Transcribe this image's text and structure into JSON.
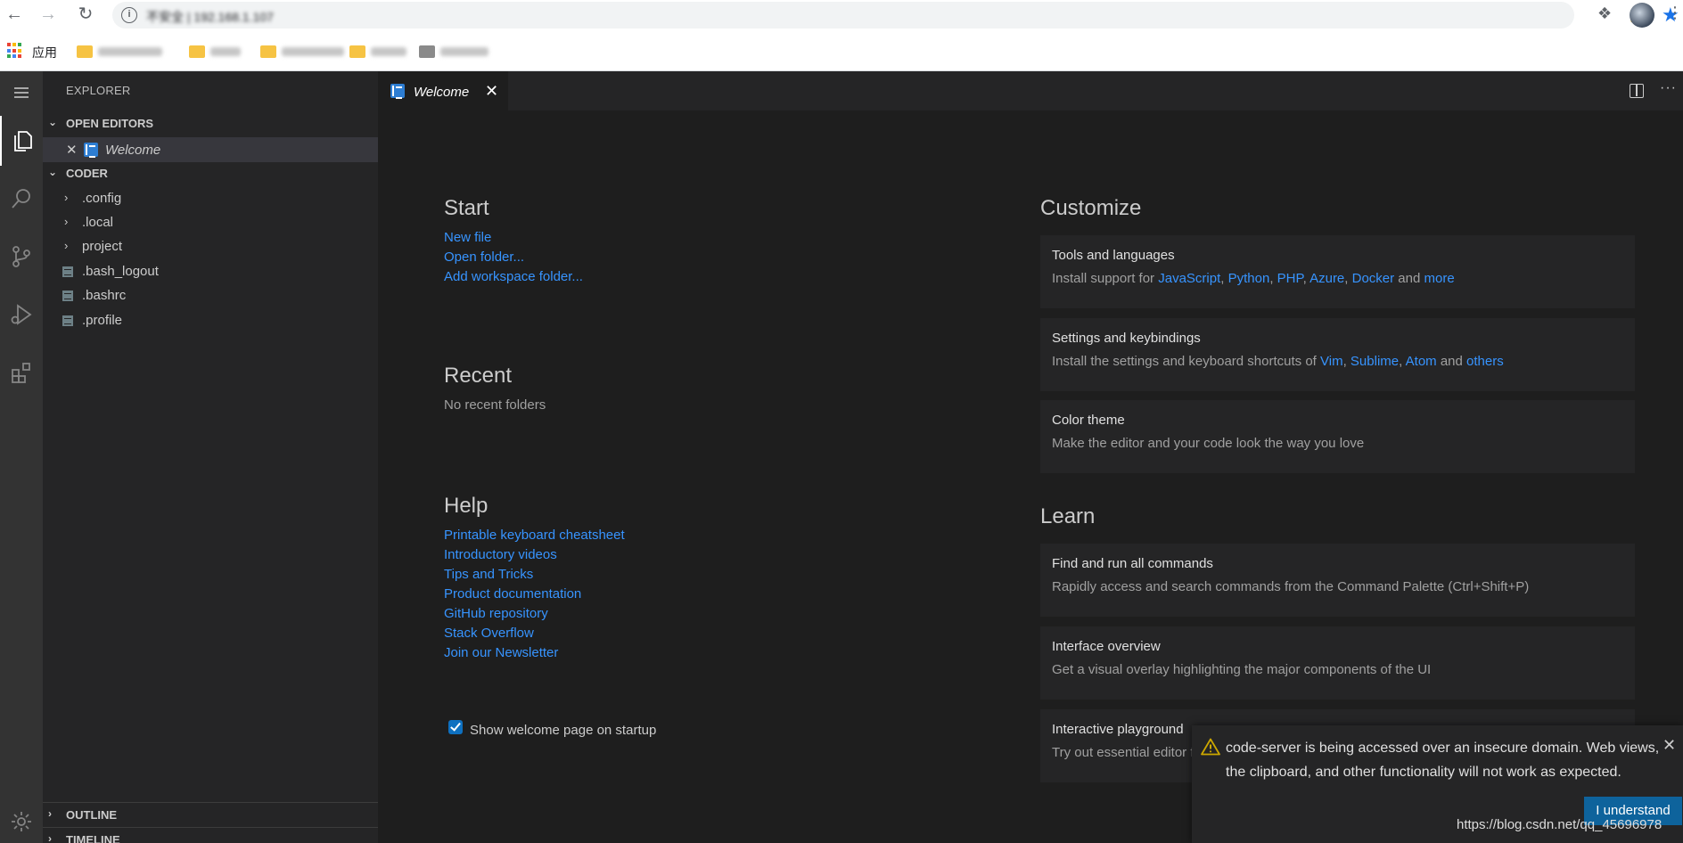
{
  "browser": {
    "url": "不安全 | 192.168.1.107",
    "apps_label": "应用"
  },
  "sidebar": {
    "title": "EXPLORER",
    "open_editors": "OPEN EDITORS",
    "open_editor_item": "Welcome",
    "folder": "CODER",
    "folders": [
      ".config",
      ".local",
      "project"
    ],
    "files": [
      ".bash_logout",
      ".bashrc",
      ".profile"
    ],
    "outline": "OUTLINE",
    "timeline": "TIMELINE"
  },
  "tab": {
    "label": "Welcome"
  },
  "welcome": {
    "start": {
      "heading": "Start",
      "links": [
        "New file",
        "Open folder...",
        "Add workspace folder..."
      ]
    },
    "recent": {
      "heading": "Recent",
      "empty": "No recent folders"
    },
    "help": {
      "heading": "Help",
      "links": [
        "Printable keyboard cheatsheet",
        "Introductory videos",
        "Tips and Tricks",
        "Product documentation",
        "GitHub repository",
        "Stack Overflow",
        "Join our Newsletter"
      ]
    },
    "show_on_startup": "Show welcome page on startup",
    "customize": {
      "heading": "Customize",
      "tools": {
        "title": "Tools and languages",
        "prefix": "Install support for ",
        "links": [
          "JavaScript",
          "Python",
          "PHP",
          "Azure",
          "Docker"
        ],
        "and": " and ",
        "more": "more"
      },
      "settings": {
        "title": "Settings and keybindings",
        "prefix": "Install the settings and keyboard shortcuts of ",
        "links": [
          "Vim",
          "Sublime",
          "Atom"
        ],
        "and": " and ",
        "more": "others"
      },
      "theme": {
        "title": "Color theme",
        "desc": "Make the editor and your code look the way you love"
      }
    },
    "learn": {
      "heading": "Learn",
      "commands": {
        "title": "Find and run all commands",
        "desc": "Rapidly access and search commands from the Command Palette (Ctrl+Shift+P)"
      },
      "interface": {
        "title": "Interface overview",
        "desc": "Get a visual overlay highlighting the major components of the UI"
      },
      "playground": {
        "title": "Interactive playground",
        "desc": "Try out essential editor features in a short walkthrough"
      }
    }
  },
  "notification": {
    "message": "code-server is being accessed over an insecure domain. Web views, the clipboard, and other functionality will not work as expected.",
    "button": "I understand"
  },
  "watermark": "https://blog.csdn.net/qq_45696978",
  "colors": {
    "link": "#3794ff",
    "activity_bar": "#333333",
    "sidebar": "#252526",
    "editor": "#1e1e1e",
    "button": "#0e639c"
  }
}
